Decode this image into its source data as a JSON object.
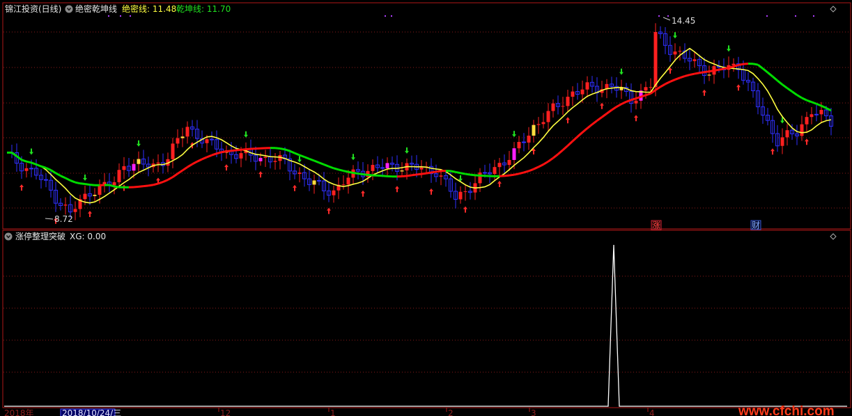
{
  "top_panel": {
    "stock_title": "锦江投资(日线)",
    "indicator_name": "绝密乾坤线",
    "line1_label": "绝密线: 11.48",
    "line2_label": "乾坤线: 11.70",
    "high_label": "14.45",
    "low_label": "8.72",
    "event_marker_1": "涨",
    "event_marker_2": "财"
  },
  "bottom_panel": {
    "indicator_name": "涨停整理突破",
    "value_label": "XG: 0.00"
  },
  "x_axis": {
    "year_label": "2018年",
    "cursor_date": "2018/10/24/三",
    "month_ticks": [
      "12",
      "1",
      "2",
      "3",
      "4"
    ]
  },
  "watermark": "www.cfchi.com",
  "colors": {
    "up": "#ff2020",
    "down": "#2f2fff",
    "line_fast": "#ffff40",
    "line_slow_up": "#00dd00",
    "line_slow_down": "#ff1010",
    "grid": "#8b1a1a",
    "divider": "#b01818"
  },
  "chart_data": [
    {
      "type": "candlestick",
      "title": "锦江投资(日线)",
      "series_names": [
        "绝密线",
        "乾坤线"
      ],
      "y_high": 14.45,
      "y_low": 8.72,
      "last_values": {
        "绝密线": 11.48,
        "乾坤线": 11.7
      }
    },
    {
      "type": "line",
      "title": "涨停整理突破",
      "series": [
        {
          "name": "XG",
          "peak": 1,
          "last": 0.0
        }
      ]
    }
  ]
}
